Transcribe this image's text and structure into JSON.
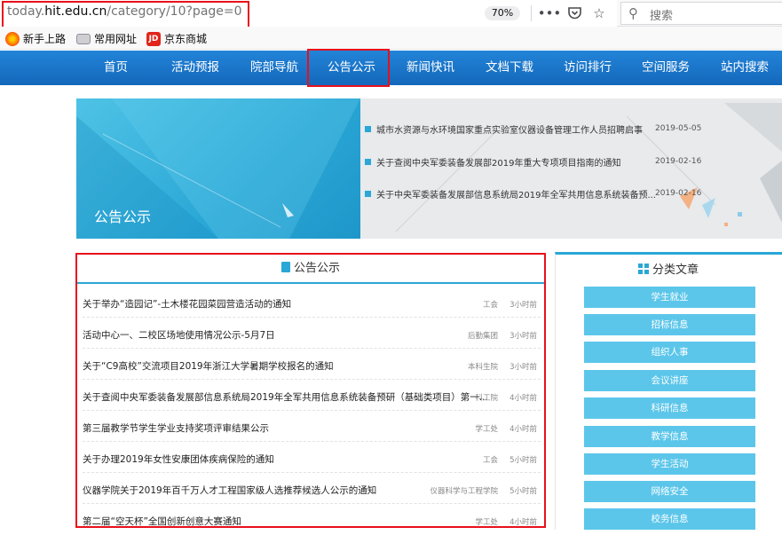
{
  "browser": {
    "url_prefix": "today.",
    "url_domain": "hit.edu.cn",
    "url_path": "/category/10?page=0",
    "zoom": "70%",
    "search_placeholder": "搜索",
    "menu_icon": "more-dots-icon",
    "pocket_icon": "pocket-icon",
    "bookmark_icon": "star-icon"
  },
  "bookmarks": [
    {
      "label": "新手上路",
      "icon": "firefox-icon"
    },
    {
      "label": "常用网址",
      "icon": "folder-icon"
    },
    {
      "label": "京东商城",
      "icon": "jd-icon"
    }
  ],
  "nav": {
    "items": [
      "首页",
      "活动预报",
      "院部导航",
      "公告公示",
      "新闻快讯",
      "文档下载",
      "访问排行",
      "空间服务",
      "站内搜索"
    ],
    "active": "公告公示",
    "color": "#1b72c8"
  },
  "banner": {
    "title": "公告公示",
    "items": [
      {
        "title": "城市水资源与水环境国家重点实验室仪器设备管理工作人员招聘启事",
        "date": "2019-05-05"
      },
      {
        "title": "关于查阅中央军委装备发展部2019年重大专项项目指南的通知",
        "date": "2019-02-16"
      },
      {
        "title": "关于中央军委装备发展部信息系统局2019年全军共用信息系统装备预...",
        "date": "2019-02-16"
      }
    ]
  },
  "panel": {
    "title": "公告公示",
    "rows": [
      {
        "title": "关于举办“造园记”-土木楼花园菜园营造活动的通知",
        "source": "工会",
        "time": "3小时前"
      },
      {
        "title": "活动中心一、二校区场地使用情况公示-5月7日",
        "source": "后勤集团",
        "time": "3小时前"
      },
      {
        "title": "关于“C9高校”交流项目2019年浙江大学暑期学校报名的通知",
        "source": "本科生院",
        "time": "3小时前"
      },
      {
        "title": "关于查阅中央军委装备发展部信息系统局2019年全军共用信息系统装备预研（基础类项目）第一...",
        "source": "科工院",
        "time": "4小时前"
      },
      {
        "title": "第三届教学节学生学业支持奖项评审结果公示",
        "source": "学工处",
        "time": "4小时前"
      },
      {
        "title": "关于办理2019年女性安康团体疾病保险的通知",
        "source": "工会",
        "time": "5小时前"
      },
      {
        "title": "仪器学院关于2019年百千万人才工程国家级人选推荐候选人公示的通知",
        "source": "仪器科学与工程学院",
        "time": "5小时前"
      },
      {
        "title": "第二届“空天杯”全国创新创意大赛通知",
        "source": "学工处",
        "time": "4小时前"
      }
    ]
  },
  "sidebar": {
    "title": "分类文章",
    "categories": [
      "学生就业",
      "招标信息",
      "组织人事",
      "会议讲座",
      "科研信息",
      "教学信息",
      "学生活动",
      "网络安全",
      "校务信息"
    ],
    "button_color": "#5cc6ea"
  }
}
